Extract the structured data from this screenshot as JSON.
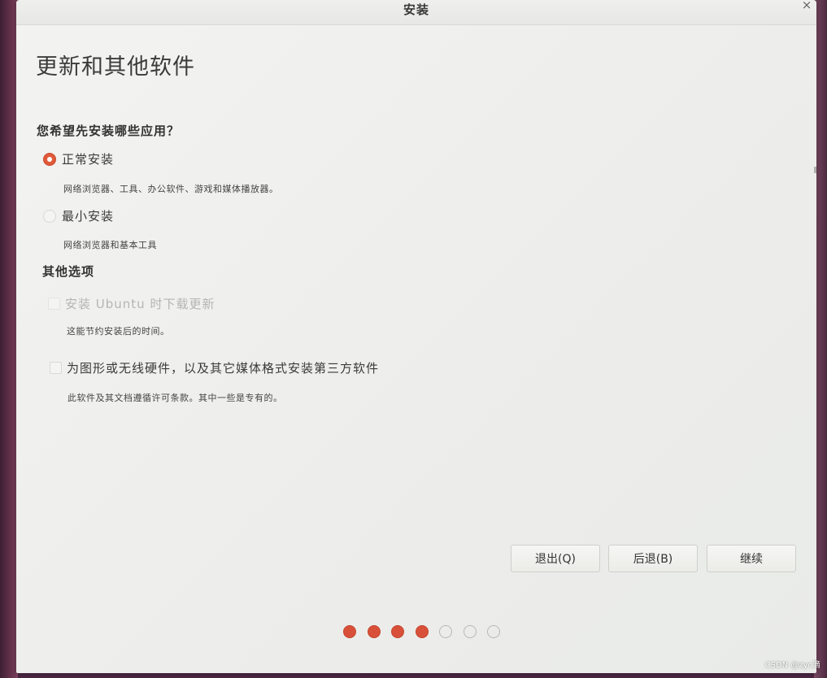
{
  "window": {
    "title": "安装",
    "close_glyph": "×"
  },
  "page": {
    "title": "更新和其他软件"
  },
  "install_type": {
    "question": "您希望先安装哪些应用？",
    "options": [
      {
        "label": "正常安装",
        "description": "网络浏览器、工具、办公软件、游戏和媒体播放器。",
        "selected": true
      },
      {
        "label": "最小安装",
        "description": "网络浏览器和基本工具",
        "selected": false
      }
    ]
  },
  "other_options": {
    "heading": "其他选项",
    "checkboxes": [
      {
        "label": "安装 Ubuntu 时下载更新",
        "description": "这能节约安装后的时间。",
        "checked": false,
        "disabled": true
      },
      {
        "label": "为图形或无线硬件，以及其它媒体格式安装第三方软件",
        "description": "此软件及其文档遵循许可条款。其中一些是专有的。",
        "checked": false,
        "disabled": false
      }
    ]
  },
  "buttons": {
    "quit": "退出(Q)",
    "back": "后退(B)",
    "continue": "继续"
  },
  "progress": {
    "total_steps": 7,
    "completed_steps": 4
  },
  "colors": {
    "accent": "#e05a3a",
    "dot_filled": "#d9503a",
    "dot_empty_border": "#b8b8b4",
    "window_bg": "#efefed"
  },
  "watermark": "CSDN @zyc滴"
}
